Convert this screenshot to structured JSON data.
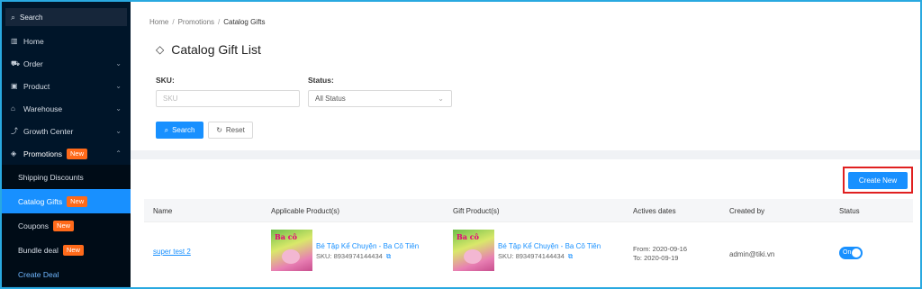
{
  "sidebar": {
    "search_label": "Search",
    "items": [
      {
        "label": "Home",
        "icon": "chart-icon"
      },
      {
        "label": "Order",
        "icon": "cart-icon"
      },
      {
        "label": "Product",
        "icon": "box-icon"
      },
      {
        "label": "Warehouse",
        "icon": "warehouse-icon"
      },
      {
        "label": "Growth Center",
        "icon": "growth-icon"
      },
      {
        "label": "Promotions",
        "icon": "tag-icon",
        "badge": "New"
      }
    ],
    "sub_items": [
      {
        "label": "Shipping Discounts"
      },
      {
        "label": "Catalog Gifts",
        "badge": "New"
      },
      {
        "label": "Coupons",
        "badge": "New"
      },
      {
        "label": "Bundle deal",
        "badge": "New"
      },
      {
        "label": "Create Deal"
      }
    ]
  },
  "breadcrumb": {
    "items": [
      "Home",
      "Promotions",
      "Catalog Gifts"
    ],
    "separator": "/"
  },
  "page_title": "Catalog Gift List",
  "filters": {
    "sku_label": "SKU:",
    "sku_placeholder": "SKU",
    "status_label": "Status:",
    "status_value": "All Status",
    "search_button": "Search",
    "reset_button": "Reset"
  },
  "create_button": "Create New",
  "table": {
    "headers": [
      "Name",
      "Applicable Product(s)",
      "Gift Product(s)",
      "Actives dates",
      "Created by",
      "Status"
    ],
    "rows": [
      {
        "name": "super test 2",
        "applicable_product": {
          "title": "Bé Tập Kể Chuyện - Ba Cô Tiên",
          "sku": "SKU: 8934974144434"
        },
        "gift_product": {
          "title": "Bé Tập Kể Chuyện - Ba Cô Tiên",
          "sku": "SKU: 8934974144434"
        },
        "from": "From: 2020-09-16",
        "to": "To: 2020-09-19",
        "created_by": "admin@tiki.vn",
        "status": "On"
      }
    ]
  },
  "thumb_logo": "Ba cô",
  "colors": {
    "primary": "#1890ff",
    "badge": "#ff6a1a",
    "sidebar": "#001529",
    "highlight_border": "#e02020"
  }
}
